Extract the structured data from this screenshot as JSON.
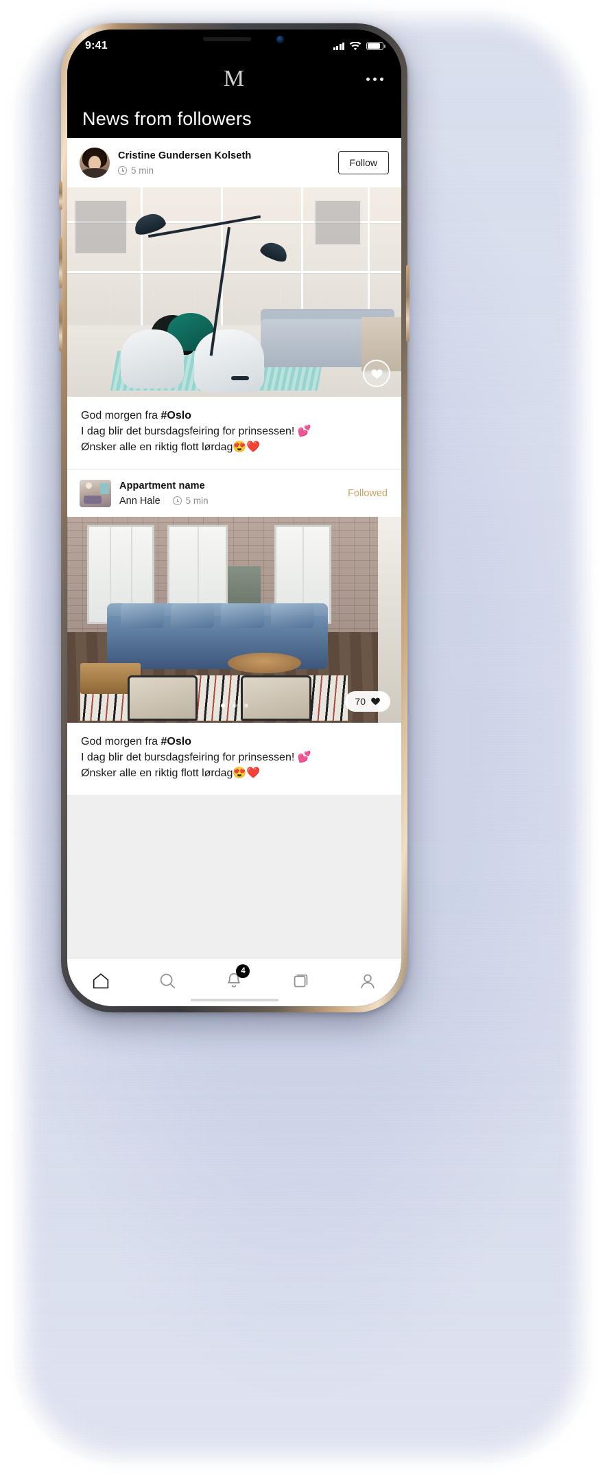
{
  "status_bar": {
    "time": "9:41",
    "signal_icon": "cellular-signal-icon",
    "wifi_icon": "wifi-icon",
    "battery_icon": "battery-icon"
  },
  "app_bar": {
    "logo": "M",
    "more_icon": "more-options-icon"
  },
  "page": {
    "title": "News from followers"
  },
  "posts": [
    {
      "author": "Cristine Gundersen Kolseth",
      "time": "5 min",
      "clock_icon": "clock-icon",
      "action_label": "Follow",
      "action_type": "button",
      "avatar_name": "user-avatar",
      "image_name": "post-image-showroom",
      "like_icon": "heart-icon",
      "caption_lines": [
        "God morgen fra #Oslo",
        "I dag blir det bursdagsfeiring for prinsessen! 💕",
        "Ønsker alle en riktig flott lørdag😍❤️"
      ],
      "caption_hashtag": "#Oslo"
    },
    {
      "author": "Appartment name",
      "subauthor": "Ann Hale",
      "time": "5 min",
      "clock_icon": "clock-icon",
      "action_label": "Followed",
      "action_type": "label",
      "avatar_name": "apartment-thumbnail",
      "image_name": "post-image-loft",
      "likes_count": "70",
      "like_icon": "heart-icon",
      "carousel_dots": 3,
      "carousel_active": 0,
      "caption_lines": [
        "God morgen fra #Oslo",
        "I dag blir det bursdagsfeiring for prinsessen! 💕",
        "Ønsker alle en riktig flott lørdag😍❤️"
      ],
      "caption_hashtag": "#Oslo"
    }
  ],
  "tabbar": {
    "items": [
      {
        "icon": "home-icon",
        "label": "Home",
        "active": true
      },
      {
        "icon": "search-icon",
        "label": "Search",
        "active": false
      },
      {
        "icon": "bell-icon",
        "label": "Notifications",
        "active": false,
        "badge": "4"
      },
      {
        "icon": "cards-icon",
        "label": "Collections",
        "active": false
      },
      {
        "icon": "profile-icon",
        "label": "Profile",
        "active": false
      }
    ]
  },
  "colors": {
    "accent_followed": "#c8a06a",
    "background_dark": "#000000",
    "card": "#ffffff",
    "feed_bg": "#efefef"
  }
}
